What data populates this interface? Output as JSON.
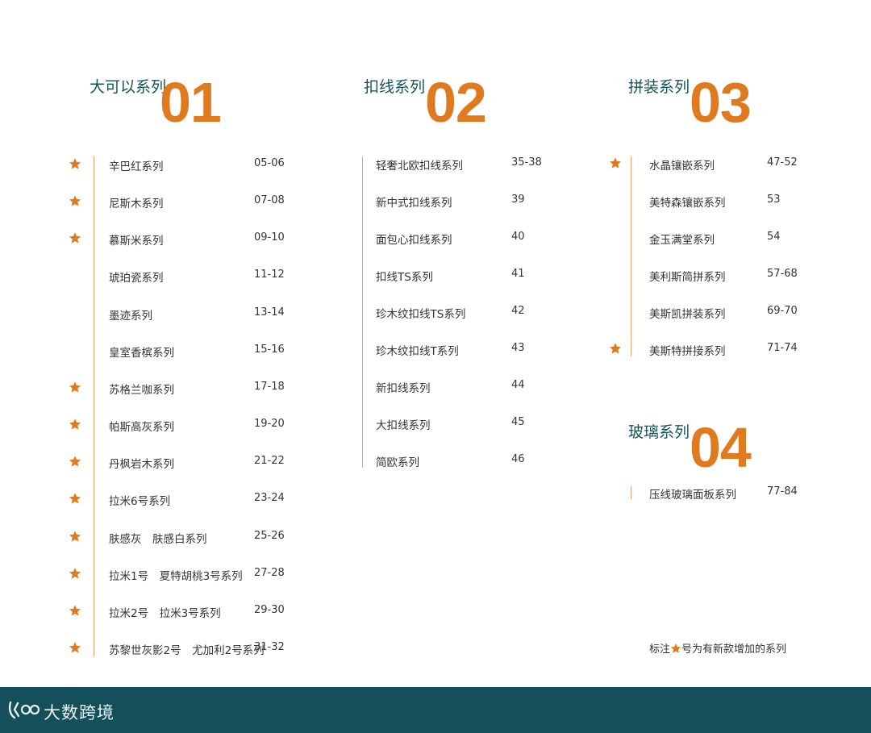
{
  "sections": [
    {
      "title": "大可以系列",
      "number": "01",
      "items": [
        {
          "name": "辛巴红系列",
          "pages": "05-06",
          "starred": true
        },
        {
          "name": "尼斯木系列",
          "pages": "07-08",
          "starred": true
        },
        {
          "name": "慕斯米系列",
          "pages": "09-10",
          "starred": true
        },
        {
          "name": "琥珀瓷系列",
          "pages": "11-12",
          "starred": false
        },
        {
          "name": "墨迹系列",
          "pages": "13-14",
          "starred": false
        },
        {
          "name": "皇室香槟系列",
          "pages": "15-16",
          "starred": false
        },
        {
          "name": "苏格兰咖系列",
          "pages": "17-18",
          "starred": true
        },
        {
          "name": "帕斯高灰系列",
          "pages": "19-20",
          "starred": true
        },
        {
          "name": "丹枫岩木系列",
          "pages": "21-22",
          "starred": true
        },
        {
          "name": "拉米6号系列",
          "pages": "23-24",
          "starred": true
        },
        {
          "name": "肤感灰　肤感白系列",
          "pages": "25-26",
          "starred": true
        },
        {
          "name": "拉米1号　夏特胡桃3号系列",
          "pages": "27-28",
          "starred": true
        },
        {
          "name": "拉米2号　拉米3号系列",
          "pages": "29-30",
          "starred": true
        },
        {
          "name": "苏黎世灰影2号　尤加利2号系列",
          "pages": "31-32",
          "starred": true
        }
      ]
    },
    {
      "title": "扣线系列",
      "number": "02",
      "items": [
        {
          "name": "轻奢北欧扣线系列",
          "pages": "35-38",
          "starred": false
        },
        {
          "name": "新中式扣线系列",
          "pages": "39",
          "starred": false
        },
        {
          "name": "面包心扣线系列",
          "pages": "40",
          "starred": false
        },
        {
          "name": "扣线TS系列",
          "pages": "41",
          "starred": false
        },
        {
          "name": "珍木纹扣线TS系列",
          "pages": "42",
          "starred": false
        },
        {
          "name": "珍木纹扣线T系列",
          "pages": "43",
          "starred": false
        },
        {
          "name": "新扣线系列",
          "pages": "44",
          "starred": false
        },
        {
          "name": "大扣线系列",
          "pages": "45",
          "starred": false
        },
        {
          "name": "简欧系列",
          "pages": "46",
          "starred": false
        }
      ]
    },
    {
      "title": "拼装系列",
      "number": "03",
      "items": [
        {
          "name": "水晶镶嵌系列",
          "pages": "47-52",
          "starred": true
        },
        {
          "name": "美特森镶嵌系列",
          "pages": "53",
          "starred": false
        },
        {
          "name": "金玉满堂系列",
          "pages": "54",
          "starred": false
        },
        {
          "name": "美利斯简拼系列",
          "pages": "57-68",
          "starred": false
        },
        {
          "name": "美斯凯拼装系列",
          "pages": "69-70",
          "starred": false
        },
        {
          "name": "美斯特拼接系列",
          "pages": "71-74",
          "starred": true
        }
      ]
    },
    {
      "title": "玻璃系列",
      "number": "04",
      "items": [
        {
          "name": "压线玻璃面板系列",
          "pages": "77-84",
          "starred": false
        }
      ]
    }
  ],
  "note": {
    "before": "标注",
    "after": "号为有新款增加的系列",
    "icon": "star-icon"
  },
  "footer": {
    "brand": "大数跨境",
    "logo_icon": "brand-logo-icon"
  },
  "colors": {
    "accent": "#e07a1f",
    "title": "#16535a",
    "footer": "#14505a",
    "rule": "#e8a36a"
  }
}
